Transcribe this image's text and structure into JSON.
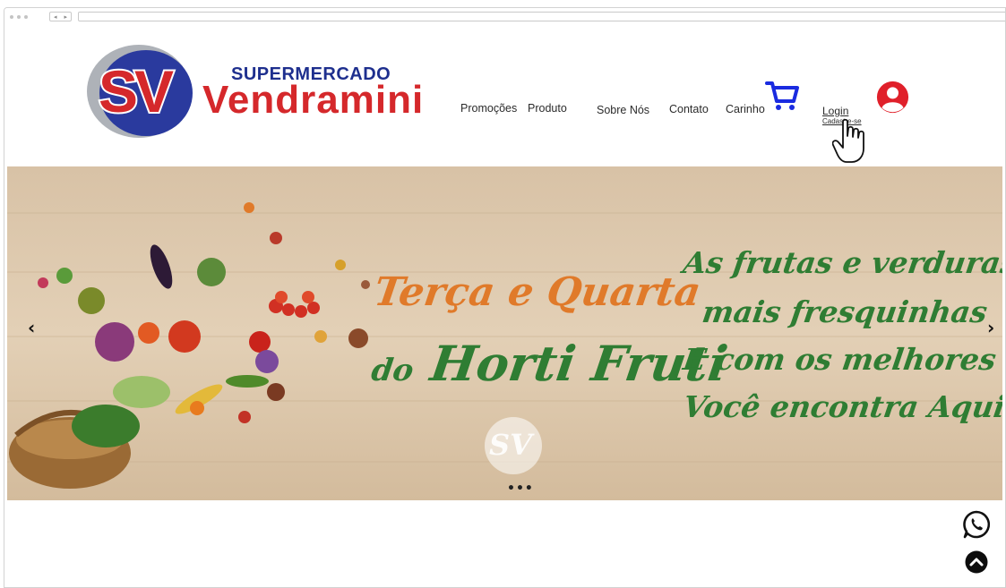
{
  "header": {
    "logo": {
      "mark": "SV",
      "top_text": "SUPERMERCADO",
      "bottom_text": "Vendramini"
    },
    "nav": [
      {
        "label": "Promoções"
      },
      {
        "label": "Produto"
      },
      {
        "label": "Sobre Nós"
      },
      {
        "label": "Contato"
      },
      {
        "label": "Carinho"
      }
    ],
    "login": {
      "label": "Login",
      "sublabel": "Cadastre-se"
    },
    "icons": {
      "cart": "cart-icon",
      "user": "user-icon",
      "cursor": "hand-pointer-icon"
    }
  },
  "hero": {
    "line1": "Terça e Quarta",
    "line2_prefix": "do",
    "line2_main": "Horti Fruti",
    "right_lines": [
      "As frutas e verduras",
      "mais fresquinhas",
      "E com os melhores preços",
      "Você encontra Aqui!"
    ],
    "watermark": "SV",
    "prev_arrow": "‹",
    "next_arrow": "›",
    "dots": "•••"
  },
  "floating": {
    "whatsapp_icon": "whatsapp-icon",
    "back_to_top_icon": "chevron-up-icon"
  },
  "colors": {
    "brand_blue": "#1e2f8e",
    "brand_red": "#d5282b",
    "cart_blue": "#1a2be0",
    "user_red": "#e0202a",
    "script_green": "#2f7d33",
    "script_orange": "#e07a2a",
    "wood": "#dcc7ac"
  }
}
